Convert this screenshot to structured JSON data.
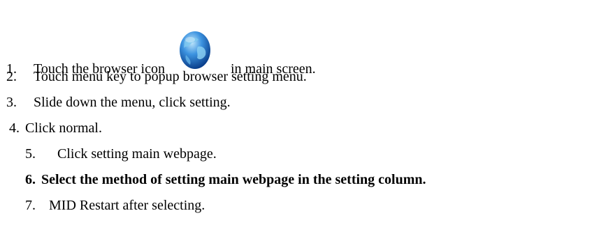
{
  "steps": [
    {
      "num": "1.",
      "before": "Touch the browser icon",
      "after": "in main screen.",
      "icon": "browser-globe-icon",
      "bold": false
    },
    {
      "num": "2.",
      "text": "Touch menu key to popup browser setting menu.",
      "bold": false
    },
    {
      "num": "3.",
      "text": "Slide down the menu, click setting.",
      "bold": false
    },
    {
      "num": "4.",
      "text": "Click normal.",
      "bold": false
    },
    {
      "num": "5.",
      "text": "Click setting main webpage.",
      "bold": false
    },
    {
      "num": "6.",
      "text": "Select the method of setting main webpage in the setting column.",
      "bold": true
    },
    {
      "num": "7.",
      "text": "MID Restart after selecting.",
      "bold": false
    }
  ],
  "colors": {
    "text": "#000000",
    "globe_ocean": "#1b6fd1",
    "globe_land": "#7ec8f0",
    "background": "#ffffff"
  }
}
